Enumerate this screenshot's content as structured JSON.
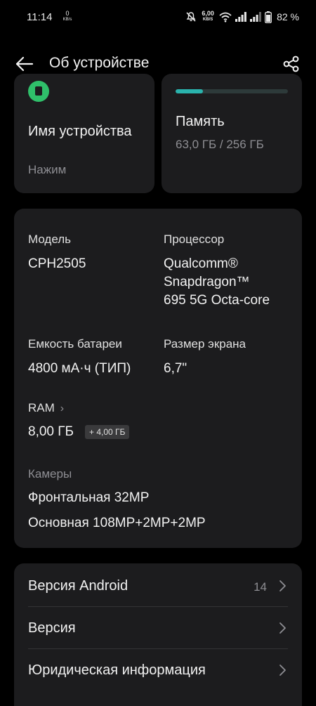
{
  "status_bar": {
    "time": "11:14",
    "net_speed_left_value": "0",
    "net_speed_left_unit": "KB/s",
    "net_speed_right_value": "6,00",
    "net_speed_right_unit": "KB/S",
    "battery_percent": "82 %",
    "icons": [
      "mute-icon",
      "wifi-icon",
      "signal-icon",
      "signal-icon",
      "battery-icon"
    ]
  },
  "header": {
    "title": "Об устройстве",
    "back_icon": "arrow-left-icon",
    "share_icon": "share-icon"
  },
  "device_name": {
    "title": "Имя устройства",
    "value": "Нажим",
    "icon": "phone-icon",
    "accent": "#2fbf6a"
  },
  "memory": {
    "title": "Память",
    "value": "63,0 ГБ / 256 ГБ",
    "used_fraction": 0.246,
    "accent": "#2ab3ad"
  },
  "specs": {
    "model": {
      "label": "Модель",
      "value": "CPH2505"
    },
    "processor": {
      "label": "Процессор",
      "value_lines": [
        "Qualcomm®",
        "Snapdragon™",
        "695 5G Octa-core"
      ]
    },
    "battery": {
      "label": "Емкость батареи",
      "value": "4800 мА·ч (ТИП)"
    },
    "screen": {
      "label": "Размер экрана",
      "value": "6,7\""
    },
    "ram": {
      "label": "RAM",
      "value": "8,00 ГБ",
      "extra": "+ 4,00 ГБ"
    },
    "cameras": {
      "label": "Камеры",
      "front": "Фронтальная 32MP",
      "main": "Основная 108MP+2MP+2MP"
    }
  },
  "list": [
    {
      "label": "Версия Android",
      "value": "14"
    },
    {
      "label": "Версия",
      "value": ""
    },
    {
      "label": "Юридическая информация",
      "value": ""
    }
  ]
}
